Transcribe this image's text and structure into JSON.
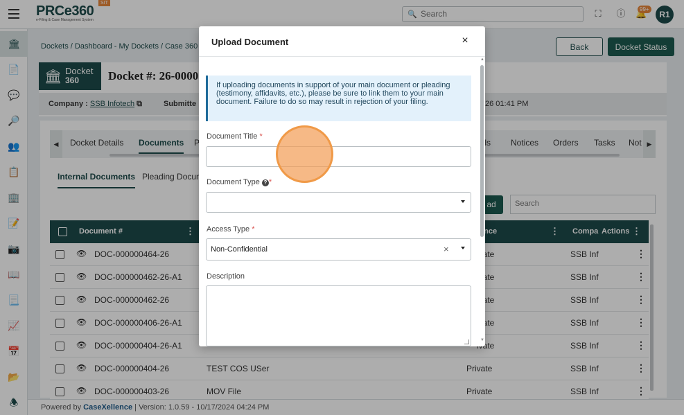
{
  "app": {
    "logo_text": "PRCe360",
    "logo_sub": "e-Filing & Case Management System",
    "env_badge": "SIT"
  },
  "topbar": {
    "search_placeholder": "Search",
    "notification_count": "99+",
    "avatar_initials": "R1"
  },
  "breadcrumb": "Dockets / Dashboard - My Dockets / Case 360",
  "header_buttons": {
    "back": "Back",
    "docket_status": "Docket Status"
  },
  "docket": {
    "logo_line1": "Docket",
    "logo_line2": "360",
    "title": "Docket #: 26-0000",
    "company_label": "Company :",
    "company_value": "SSB Infotech",
    "submitted_label": "Submitte",
    "submitted_date": "26 01:41 PM"
  },
  "tabs": [
    {
      "label": "Docket Details"
    },
    {
      "label": "Documents"
    },
    {
      "label": "P"
    },
    {
      "label": "ails"
    },
    {
      "label": "Notices"
    },
    {
      "label": "Orders"
    },
    {
      "label": "Tasks"
    },
    {
      "label": "Not"
    }
  ],
  "subtabs": [
    {
      "label": "Internal Documents"
    },
    {
      "label": "Pleading Docum"
    }
  ],
  "upload_button_fragment": "ad",
  "table_search_placeholder": "Search",
  "table": {
    "headers": {
      "doc_no": "Document #",
      "confidence": "ence",
      "company": "Compa",
      "actions": "Actions"
    },
    "rows": [
      {
        "doc": "DOC-000000464-26",
        "title": "",
        "access": "ivate",
        "company": "SSB Inf"
      },
      {
        "doc": "DOC-000000462-26-A1",
        "title": "",
        "access": "ivate",
        "company": "SSB Inf"
      },
      {
        "doc": "DOC-000000462-26",
        "title": "",
        "access": "ivate",
        "company": "SSB Inf"
      },
      {
        "doc": "DOC-000000406-26-A1",
        "title": "",
        "access": "ivate",
        "company": "SSB Inf"
      },
      {
        "doc": "DOC-000000404-26-A1",
        "title": "",
        "access": "ivate",
        "company": "SSB Inf"
      },
      {
        "doc": "DOC-000000404-26",
        "title": "TEST COS USer",
        "access": "Private",
        "company": "SSB Inf"
      },
      {
        "doc": "DOC-000000403-26",
        "title": "MOV File",
        "access": "Private",
        "company": "SSB Inf"
      }
    ]
  },
  "footer": {
    "powered_by": "Powered by",
    "brand": "CaseXellence",
    "version": "|  Version: 1.0.59 - 10/17/2024 04:24 PM"
  },
  "modal": {
    "title": "Upload Document",
    "close_glyph": "×",
    "info_text": "If uploading documents in support of your main document or pleading (testimony, affidavits, etc.), please be sure to link them to your main document. Failure to do so may result in rejection of your filing.",
    "fields": {
      "document_title_label": "Document Title",
      "document_title_value": "",
      "document_type_label": "Document Type",
      "document_type_value": "",
      "access_type_label": "Access Type",
      "access_type_value": "Non-Confidential",
      "description_label": "Description",
      "description_value": ""
    },
    "required_mark": "*"
  }
}
